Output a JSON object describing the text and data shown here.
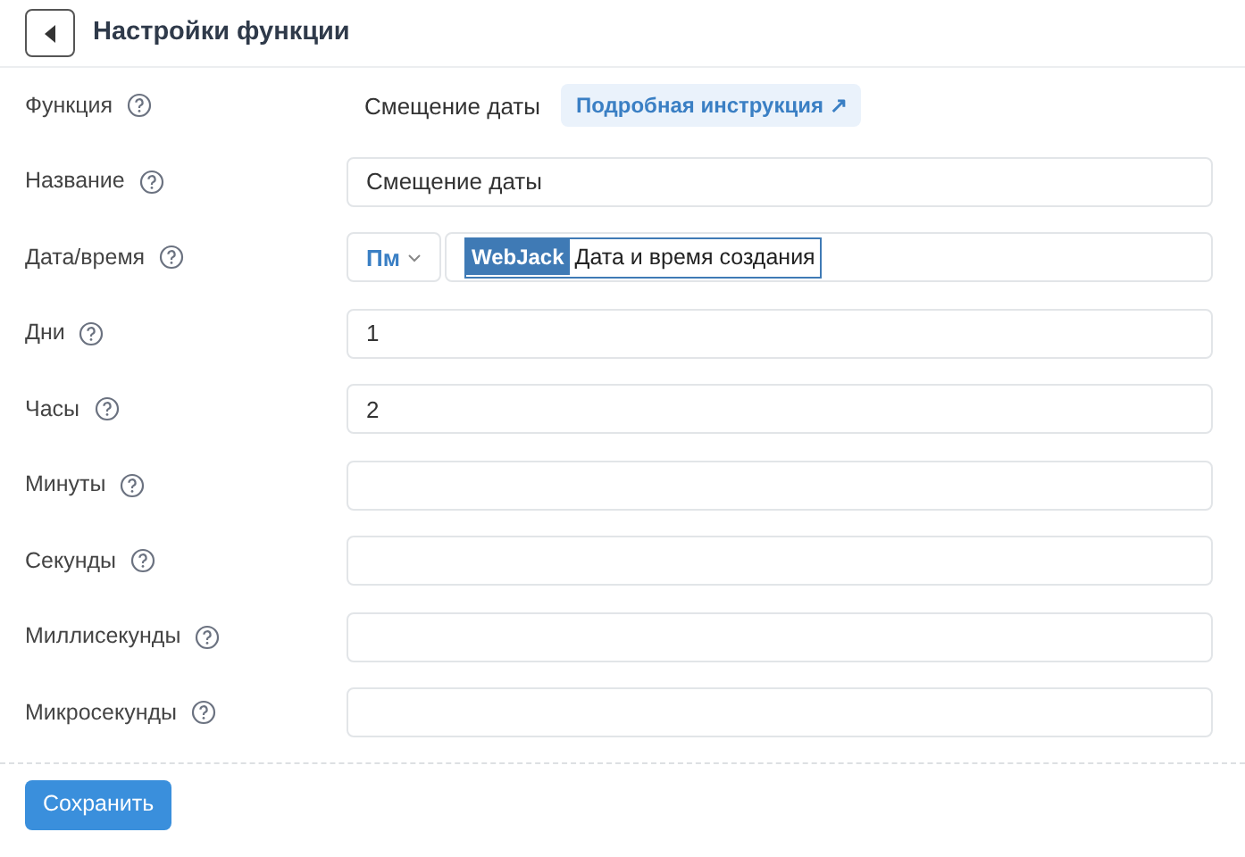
{
  "header": {
    "title": "Настройки функции"
  },
  "rows": [
    {
      "kind": "info",
      "label": "Функция",
      "value": "Смещение даты",
      "link": "Подробная инструкция ↗"
    },
    {
      "kind": "text",
      "label": "Название",
      "value": "Смещение даты"
    },
    {
      "kind": "tag",
      "label": "Дата/время",
      "prefix": "Пм",
      "tag": "WebJack",
      "value": "Дата и время создания"
    },
    {
      "kind": "text",
      "label": "Дни",
      "value": "1"
    },
    {
      "kind": "text",
      "label": "Часы",
      "value": "2"
    },
    {
      "kind": "text",
      "label": "Минуты"
    },
    {
      "kind": "text",
      "label": "Секунды"
    },
    {
      "kind": "text",
      "label": "Миллисекунды"
    },
    {
      "kind": "text",
      "label": "Микросекунды"
    }
  ],
  "save_button": "Сохранить"
}
